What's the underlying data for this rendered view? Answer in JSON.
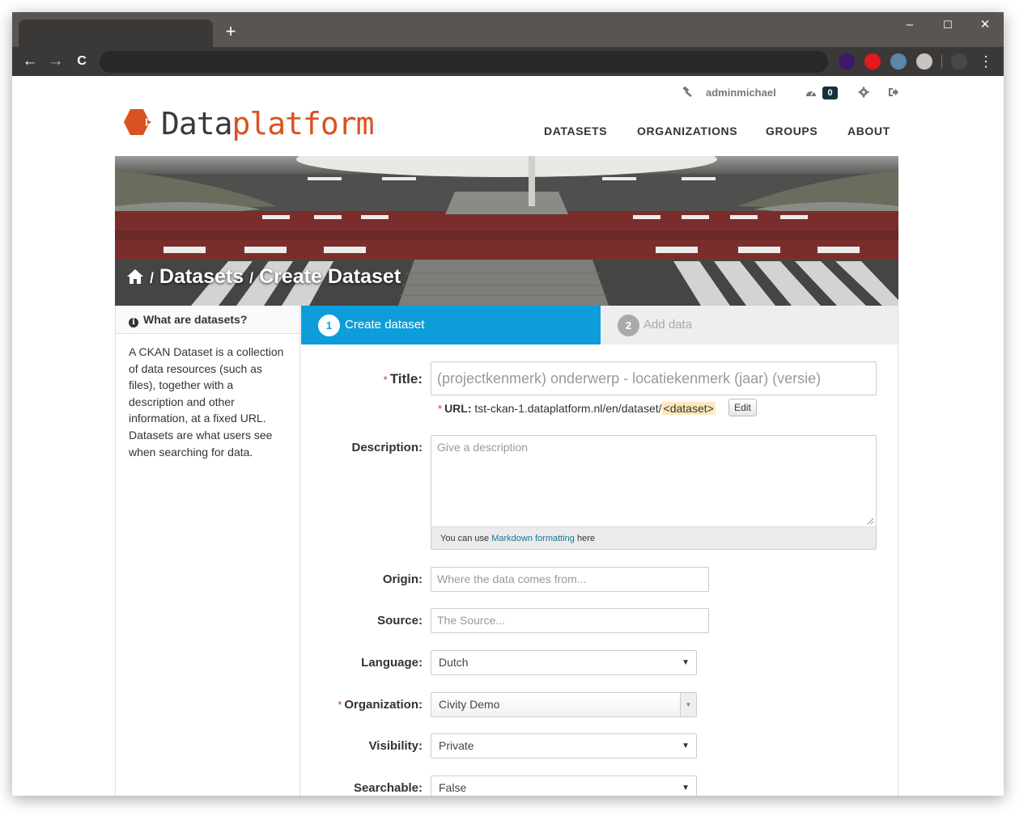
{
  "browser": {
    "new_tab_symbol": "+",
    "controls": {
      "minimize": "–",
      "maximize": "☐",
      "close": "✕"
    },
    "nav": {
      "back": "←",
      "forward": "→",
      "reload": "C"
    },
    "extension_colors": [
      "#3b1a6e",
      "#e11b1b",
      "#5b86a8",
      "#c9c2be",
      "#4a4846"
    ]
  },
  "account": {
    "username": "adminmichael",
    "activity_count": "0"
  },
  "brand": {
    "name_part1": "Data",
    "name_part2": "platform",
    "accent_color": "#d9521f"
  },
  "nav": {
    "datasets": "DATASETS",
    "organizations": "ORGANIZATIONS",
    "groups": "GROUPS",
    "about": "ABOUT"
  },
  "breadcrumb": {
    "separator": "/",
    "datasets": "Datasets",
    "current": "Create Dataset"
  },
  "sidebar": {
    "heading": "What are datasets?",
    "body": "A CKAN Dataset is a collection of data resources (such as files), together with a description and other information, at a fixed URL. Datasets are what users see when searching for data."
  },
  "stages": [
    {
      "number": "1",
      "label": "Create dataset",
      "active": true
    },
    {
      "number": "2",
      "label": "Add data",
      "active": false
    }
  ],
  "form": {
    "required_mark": "*",
    "title": {
      "label": "Title:",
      "placeholder": "(projectkenmerk) onderwerp - locatiekenmerk (jaar) (versie)"
    },
    "url": {
      "label": "URL:",
      "prefix": "tst-ckan-1.dataplatform.nl/en/dataset/",
      "slug": "<dataset>",
      "edit_label": "Edit"
    },
    "description": {
      "label": "Description:",
      "placeholder": "Give a description",
      "hint_prefix": "You can use ",
      "hint_link": "Markdown formatting",
      "hint_suffix": " here"
    },
    "origin": {
      "label": "Origin:",
      "placeholder": "Where the data comes from..."
    },
    "source": {
      "label": "Source:",
      "placeholder": "The Source..."
    },
    "language": {
      "label": "Language:",
      "value": "Dutch"
    },
    "organization": {
      "label": "Organization:",
      "value": "Civity Demo"
    },
    "visibility": {
      "label": "Visibility:",
      "value": "Private"
    },
    "searchable": {
      "label": "Searchable:",
      "value": "False"
    }
  }
}
